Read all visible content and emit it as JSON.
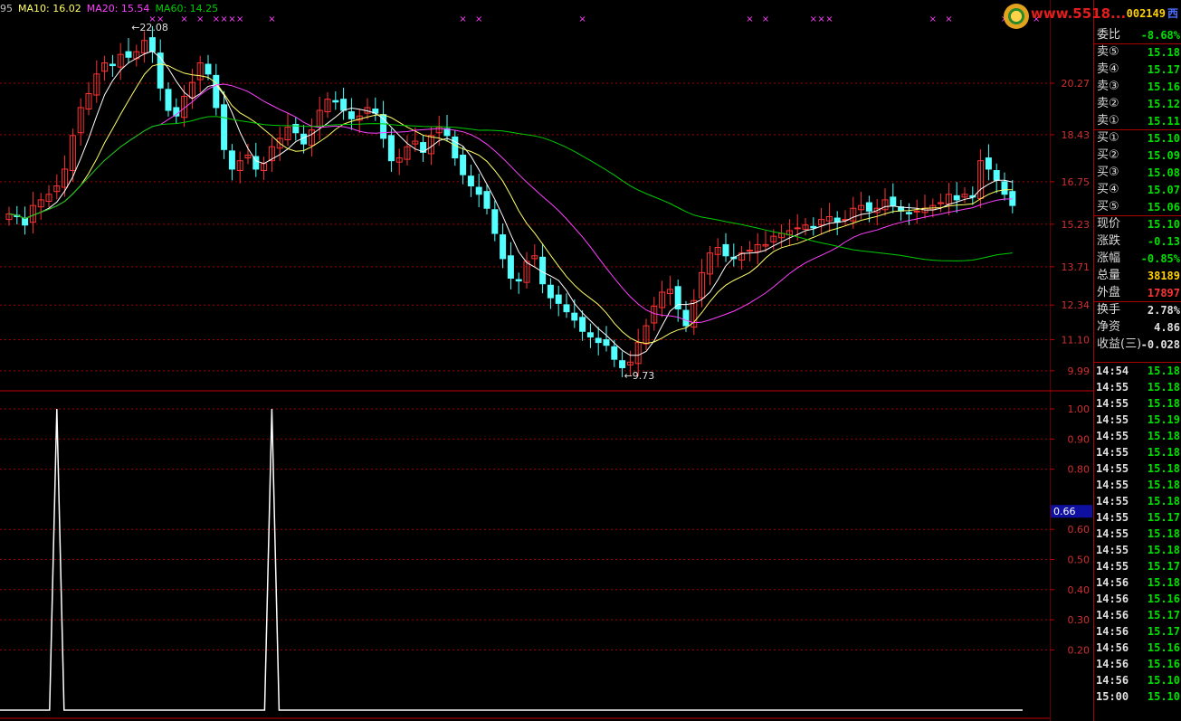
{
  "header": {
    "prefix": "95",
    "ma10_label": "MA10: 16.02",
    "ma20_label": "MA20: 15.54",
    "ma60_label": "MA60: 14.25",
    "code": "002149",
    "code_suffix": "西",
    "watermark": "www.5518..."
  },
  "colors": {
    "up": "#ff3232",
    "down": "#54ffff",
    "ma5": "#ffffff",
    "ma10": "#ffff66",
    "ma20": "#ff40ff",
    "ma60": "#00cc00",
    "grid": "#a00000"
  },
  "price_axis": {
    "labels": [
      "20.27",
      "18.43",
      "16.75",
      "15.23",
      "13.71",
      "12.34",
      "11.10",
      "9.99"
    ],
    "min": 9.5,
    "max": 22.6
  },
  "indicator_axis": {
    "labels": [
      "1.00",
      "0.90",
      "0.80",
      "0.60",
      "0.50",
      "0.40",
      "0.30",
      "0.20"
    ],
    "current": "0.66"
  },
  "annotations": {
    "high": "22.08",
    "low": "9.73"
  },
  "quote": {
    "rows": [
      {
        "k": "委比",
        "v": "-8.68%",
        "c": "#00e000"
      },
      {
        "k": "卖⑤",
        "v": "15.18",
        "c": "#00e000"
      },
      {
        "k": "卖④",
        "v": "15.17",
        "c": "#00e000"
      },
      {
        "k": "卖③",
        "v": "15.16",
        "c": "#00e000"
      },
      {
        "k": "卖②",
        "v": "15.12",
        "c": "#00e000"
      },
      {
        "k": "卖①",
        "v": "15.11",
        "c": "#00e000"
      },
      {
        "k": "买①",
        "v": "15.10",
        "c": "#00e000"
      },
      {
        "k": "买②",
        "v": "15.09",
        "c": "#00e000"
      },
      {
        "k": "买③",
        "v": "15.08",
        "c": "#00e000"
      },
      {
        "k": "买④",
        "v": "15.07",
        "c": "#00e000"
      },
      {
        "k": "买⑤",
        "v": "15.06",
        "c": "#00e000"
      },
      {
        "k": "现价",
        "v": "15.10",
        "c": "#00e000"
      },
      {
        "k": "涨跌",
        "v": "-0.13",
        "c": "#00e000"
      },
      {
        "k": "涨幅",
        "v": "-0.85%",
        "c": "#00e000"
      },
      {
        "k": "总量",
        "v": "38189",
        "c": "#ffd000"
      },
      {
        "k": "外盘",
        "v": "17897",
        "c": "#ff3232"
      },
      {
        "k": "换手",
        "v": "2.78%",
        "c": "#e0e0e0"
      },
      {
        "k": "净资",
        "v": "4.86",
        "c": "#e0e0e0"
      },
      {
        "k": "收益(三)",
        "v": "-0.028",
        "c": "#e0e0e0"
      }
    ]
  },
  "ticks": [
    {
      "t": "14:54",
      "p": "15.18"
    },
    {
      "t": "14:55",
      "p": "15.18"
    },
    {
      "t": "14:55",
      "p": "15.18"
    },
    {
      "t": "14:55",
      "p": "15.19"
    },
    {
      "t": "14:55",
      "p": "15.18"
    },
    {
      "t": "14:55",
      "p": "15.18"
    },
    {
      "t": "14:55",
      "p": "15.18"
    },
    {
      "t": "14:55",
      "p": "15.18"
    },
    {
      "t": "14:55",
      "p": "15.18"
    },
    {
      "t": "14:55",
      "p": "15.17"
    },
    {
      "t": "14:55",
      "p": "15.18"
    },
    {
      "t": "14:55",
      "p": "15.18"
    },
    {
      "t": "14:55",
      "p": "15.17"
    },
    {
      "t": "14:56",
      "p": "15.18"
    },
    {
      "t": "14:56",
      "p": "15.16"
    },
    {
      "t": "14:56",
      "p": "15.17"
    },
    {
      "t": "14:56",
      "p": "15.17"
    },
    {
      "t": "14:56",
      "p": "15.16"
    },
    {
      "t": "14:56",
      "p": "15.16"
    },
    {
      "t": "14:56",
      "p": "15.10"
    },
    {
      "t": "15:00",
      "p": "15.10"
    }
  ],
  "chart_data": {
    "type": "candlestick",
    "closes": [
      15.6,
      15.5,
      15.2,
      15.9,
      16.1,
      16.3,
      16.6,
      17.2,
      18.4,
      19.4,
      19.9,
      20.6,
      21.0,
      20.9,
      21.3,
      21.2,
      21.4,
      21.8,
      21.4,
      20.1,
      19.3,
      19.1,
      19.8,
      20.3,
      21.0,
      20.6,
      19.4,
      17.9,
      17.2,
      17.5,
      17.7,
      17.2,
      17.4,
      18.0,
      18.3,
      18.7,
      18.5,
      18.1,
      18.6,
      19.3,
      19.7,
      19.6,
      19.3,
      19.0,
      19.1,
      19.4,
      19.2,
      18.3,
      17.5,
      17.6,
      18.0,
      18.2,
      17.8,
      18.4,
      18.7,
      18.4,
      17.6,
      17.0,
      16.6,
      16.3,
      15.8,
      14.9,
      14.0,
      13.3,
      13.2,
      13.9,
      14.1,
      13.1,
      12.6,
      12.4,
      12.1,
      11.8,
      11.4,
      11.2,
      11.0,
      10.9,
      10.4,
      10.1,
      10.3,
      11.0,
      11.6,
      12.3,
      12.8,
      12.9,
      12.2,
      11.6,
      12.5,
      13.5,
      14.2,
      14.4,
      14.1,
      14.0,
      14.2,
      14.3,
      14.5,
      14.5,
      14.8,
      14.9,
      15.0,
      15.1,
      15.2,
      15.1,
      15.4,
      15.5,
      15.3,
      15.4,
      15.8,
      15.9,
      15.7,
      15.8,
      16.1,
      15.9,
      15.7,
      15.6,
      15.7,
      15.8,
      15.9,
      16.0,
      16.3,
      16.1,
      16.3,
      16.2,
      17.5,
      17.2,
      16.8,
      16.3,
      15.9
    ],
    "indicator_peaks": [
      {
        "index": 6,
        "value": 1.0
      },
      {
        "index": 33,
        "value": 1.0
      }
    ],
    "marker_positions": [
      18,
      19,
      22,
      24,
      26,
      27,
      28,
      29,
      33,
      57,
      59,
      72,
      93,
      95,
      101,
      102,
      103,
      116,
      118,
      125,
      127,
      129,
      134
    ]
  }
}
